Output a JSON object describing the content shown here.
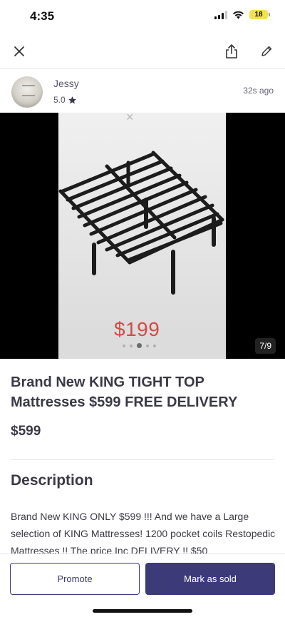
{
  "status": {
    "time": "4:35",
    "battery": "18"
  },
  "seller": {
    "name": "Jessy",
    "rating": "5.0",
    "posted": "32s ago"
  },
  "photo": {
    "price_overlay": "$199",
    "counter": "7/9"
  },
  "listing": {
    "title": "Brand New KING TIGHT TOP Mattresses $599 FREE DELIVERY",
    "price": "$599",
    "description_heading": "Description",
    "description": "Brand New KING ONLY $599 !!! And we have a Large selection of KING Mattresses! 1200 pocket coils Restopedic Mattresses !! The price Inc DELIVERY !! $50"
  },
  "actions": {
    "promote": "Promote",
    "mark_sold": "Mark as sold"
  },
  "icons": {
    "close": "close-icon",
    "share": "share-icon",
    "edit": "edit-icon",
    "star": "star-icon"
  },
  "colors": {
    "primary": "#3d3a7a",
    "text": "#3a3a46",
    "price_overlay": "#d14b47"
  }
}
